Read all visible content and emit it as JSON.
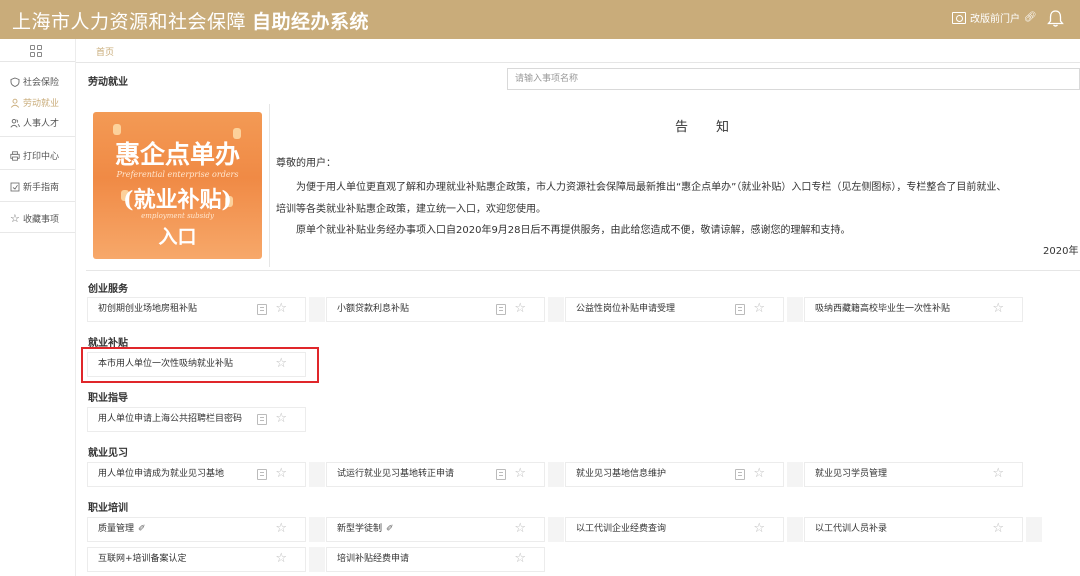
{
  "header": {
    "title_main": "上海市人力资源和社会保障",
    "title_bold": "自助经办系统",
    "portal_label": "改版前门户"
  },
  "sidebar": {
    "items": [
      {
        "label": "社会保险",
        "icon": "shield-icon"
      },
      {
        "label": "劳动就业",
        "icon": "user-icon",
        "active": true
      },
      {
        "label": "人事人才",
        "icon": "people-icon"
      },
      {
        "label": "打印中心",
        "icon": "printer-icon"
      },
      {
        "label": "新手指南",
        "icon": "guide-icon"
      },
      {
        "label": "收藏事项",
        "icon": "star-icon"
      }
    ]
  },
  "breadcrumb": "首页",
  "section_title": "劳动就业",
  "search": {
    "placeholder": "请输入事项名称"
  },
  "banner": {
    "line1": "惠企点单办",
    "line2": "Preferential enterprise orders",
    "line3": "(就业补贴)",
    "line4": "employment subsidy",
    "line5": "入口"
  },
  "notice": {
    "title": "告知",
    "greeting": "尊敬的用户：",
    "para1a": "为便于用人单位更直观了解和办理就业补贴惠企政策，市人力资源社会保障局最新推出“惠企点单办”（就业补贴）入口专栏（见左侧图标），专栏整合了目前就业、",
    "para1b": "培训等各类就业补贴惠企政策，建立统一入口，欢迎您使用。",
    "para2": "原单个就业补贴业务经办事项入口自2020年9月28日后不再提供服务，由此给您造成不便，敬请谅解，感谢您的理解和支持。",
    "date": "2020年"
  },
  "categories": [
    {
      "title": "创业服务",
      "items": [
        "初创期创业场地房租补贴",
        "小额贷款利息补贴",
        "公益性岗位补贴申请受理",
        "吸纳西藏籍高校毕业生一次性补贴"
      ]
    },
    {
      "title": "就业补贴",
      "items": [
        "本市用人单位一次性吸纳就业补贴"
      ]
    },
    {
      "title": "职业指导",
      "items": [
        "用人单位申请上海公共招聘栏目密码"
      ]
    },
    {
      "title": "就业见习",
      "items": [
        "用人单位申请成为就业见习基地",
        "试运行就业见习基地转正申请",
        "就业见习基地信息维护",
        "就业见习学员管理"
      ]
    },
    {
      "title": "职业培训",
      "items": [
        "质量管理",
        "新型学徒制",
        "以工代训企业经费查询",
        "以工代训人员补录",
        "互联网+培训备案认定",
        "培训补贴经费申请"
      ]
    }
  ]
}
